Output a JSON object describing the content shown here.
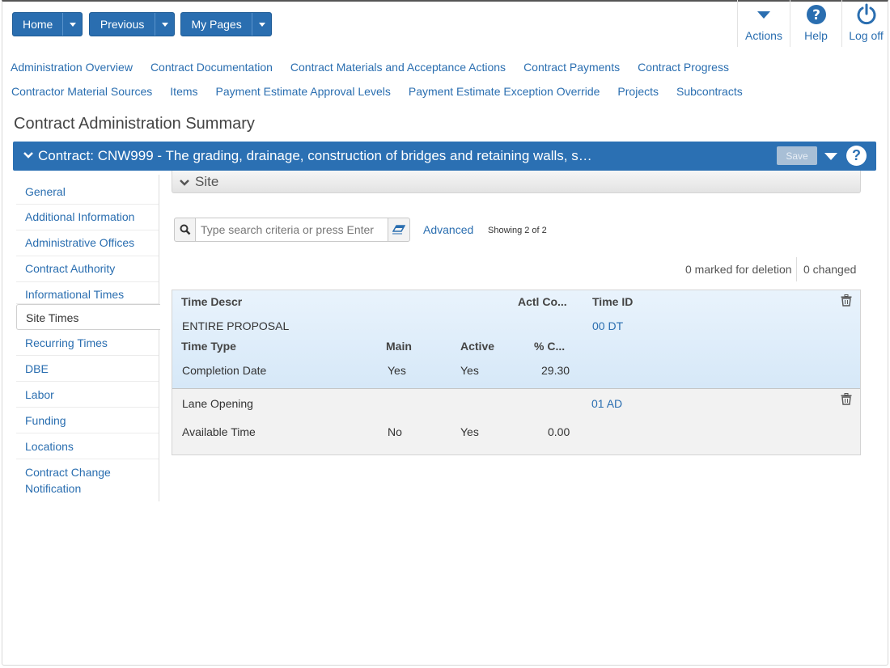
{
  "nav": {
    "home": "Home",
    "previous": "Previous",
    "my_pages": "My Pages"
  },
  "toolbar": {
    "actions": "Actions",
    "help": "Help",
    "logoff": "Log off"
  },
  "links_row1": [
    "Administration Overview",
    "Contract Documentation",
    "Contract Materials and Acceptance Actions",
    "Contract Payments",
    "Contract Progress"
  ],
  "links_row2": [
    "Contractor Material Sources",
    "Items",
    "Payment Estimate Approval Levels",
    "Payment Estimate Exception Override",
    "Projects",
    "Subcontracts"
  ],
  "page_title": "Contract Administration Summary",
  "contract_bar": {
    "text": "Contract: CNW999 - The grading, drainage, construction of bridges and retaining walls, s…",
    "save": "Save"
  },
  "sidebar": [
    "General",
    "Additional Information",
    "Administrative Offices",
    "Contract Authority",
    "Informational Times",
    "Site Times",
    "Recurring Times",
    "DBE",
    "Labor",
    "Funding",
    "Locations",
    "Contract Change Notification"
  ],
  "sidebar_active": "Site Times",
  "site": {
    "title": "Site",
    "search_placeholder": "Type search criteria or press Enter",
    "advanced": "Advanced",
    "showing": "Showing 2 of 2",
    "marked_for_deletion": "0 marked for deletion",
    "changed": "0 changed"
  },
  "grid": {
    "headers": {
      "time_descr": "Time Descr",
      "actl_co": "Actl Co...",
      "time_id": "Time ID",
      "time_type": "Time Type",
      "main": "Main",
      "active": "Active",
      "pct": "% C..."
    },
    "rows": [
      {
        "descr": "ENTIRE PROPOSAL",
        "time_id": "00 DT",
        "time_type": "Completion Date",
        "main": "Yes",
        "active": "Yes",
        "pct": "29.30"
      },
      {
        "descr": "Lane Opening",
        "time_id": "01 AD",
        "time_type": "Available Time",
        "main": "No",
        "active": "Yes",
        "pct": "0.00"
      }
    ]
  }
}
